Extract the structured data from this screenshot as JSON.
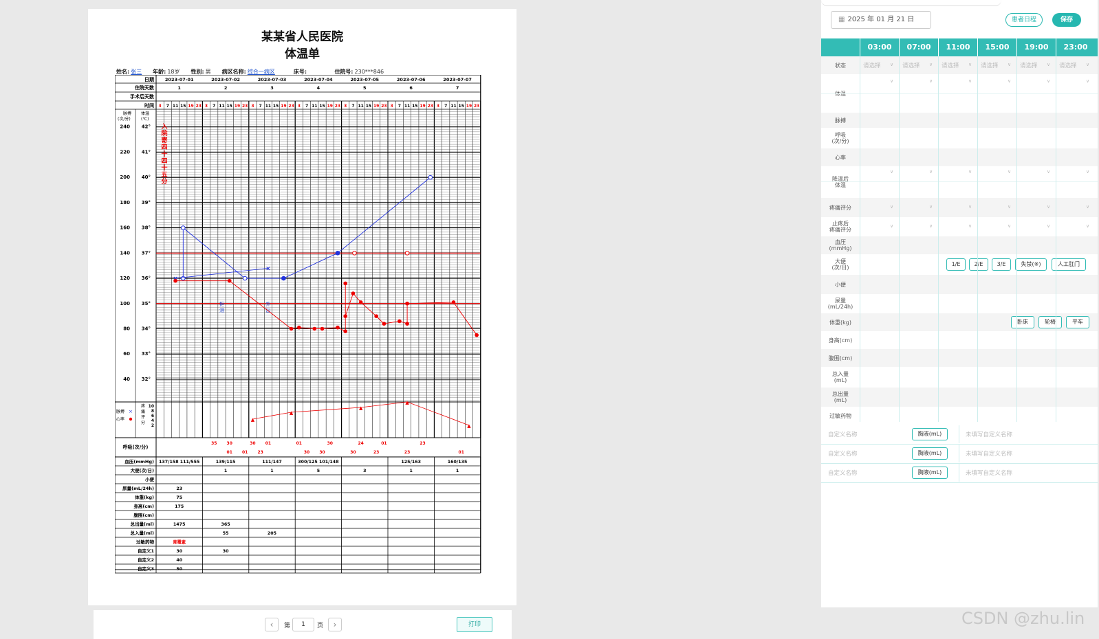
{
  "hospital": "某某省人民医院",
  "doc_title": "体温单",
  "patient": {
    "name_label": "姓名:",
    "name": "张三",
    "age_label": "年龄:",
    "age": "18岁",
    "sex_label": "性别:",
    "sex": "男",
    "ward_label": "病区名称:",
    "ward": "综合一病区",
    "bed_label": "床号:",
    "bed": "",
    "inpatient_label": "住院号:",
    "inpatient_no": "230***846"
  },
  "chart": {
    "row_labels": {
      "date": "日期",
      "days": "住院天数",
      "op_days": "手术后天数",
      "time": "时间"
    },
    "dates": [
      "2023-07-01",
      "2023-07-02",
      "2023-07-03",
      "2023-07-04",
      "2023-07-05",
      "2023-07-06",
      "2023-07-07"
    ],
    "hosp_days": [
      "1",
      "2",
      "3",
      "4",
      "5",
      "6",
      "7"
    ],
    "times": [
      "3",
      "7",
      "11",
      "15",
      "19",
      "23"
    ],
    "pulse_axis_label": "脉搏\n(次/分)",
    "temp_axis_label": "体温\n(℃)",
    "pulse_ticks": [
      "240",
      "220",
      "200",
      "180",
      "160",
      "140",
      "120",
      "100",
      "80",
      "60",
      "40"
    ],
    "temp_ticks": [
      "42°",
      "41°",
      "40°",
      "39°",
      "38°",
      "37°",
      "36°",
      "35°",
      "34°",
      "33°",
      "32°"
    ],
    "admission_note": "入院寄四十四十五分",
    "notes": [
      {
        "day": 1,
        "text": "拒测"
      },
      {
        "day": 2,
        "text": "外出"
      }
    ],
    "legend_pulse": "脉搏",
    "legend_hr": "心率",
    "pain_label": "疼痛评分",
    "pain_ticks": [
      "10",
      "8",
      "6",
      "4",
      "2"
    ],
    "resp_label": "呼吸(次/分)",
    "resp_values": [
      {
        "day": 1,
        "slot": 1,
        "v": "35",
        "lo": false
      },
      {
        "day": 1,
        "slot": 3,
        "v": "30",
        "lo": false
      },
      {
        "day": 1,
        "slot": 3,
        "v": "01",
        "lo": true
      },
      {
        "day": 2,
        "slot": 0,
        "v": "30",
        "lo": false
      },
      {
        "day": 1,
        "slot": 5,
        "v": "01",
        "lo": true
      },
      {
        "day": 2,
        "slot": 2,
        "v": "01",
        "lo": false
      },
      {
        "day": 2,
        "slot": 1,
        "v": "23",
        "lo": true
      },
      {
        "day": 3,
        "slot": 0,
        "v": "01",
        "lo": false
      },
      {
        "day": 3,
        "slot": 1,
        "v": "30",
        "lo": true
      },
      {
        "day": 3,
        "slot": 4,
        "v": "30",
        "lo": false
      },
      {
        "day": 3,
        "slot": 3,
        "v": "30",
        "lo": true
      },
      {
        "day": 4,
        "slot": 2,
        "v": "24",
        "lo": false
      },
      {
        "day": 4,
        "slot": 1,
        "v": "30",
        "lo": true
      },
      {
        "day": 4,
        "slot": 5,
        "v": "01",
        "lo": false
      },
      {
        "day": 4,
        "slot": 4,
        "v": "23",
        "lo": true
      },
      {
        "day": 5,
        "slot": 4,
        "v": "23",
        "lo": false
      },
      {
        "day": 5,
        "slot": 2,
        "v": "23",
        "lo": true
      },
      {
        "day": 6,
        "slot": 3,
        "v": "01",
        "lo": true
      }
    ],
    "bottom_rows": [
      {
        "label": "血压(mmHg)",
        "cells": [
          "137/158  111/555",
          "139/115",
          "111/147",
          "300/125  101/148",
          "",
          "125/163",
          "160/135"
        ]
      },
      {
        "label": "大便(次/日)",
        "cells": [
          "",
          "1",
          "1",
          "5",
          "3",
          "1",
          "1"
        ]
      },
      {
        "label": "小便",
        "cells": [
          "",
          "",
          "",
          "",
          "",
          "",
          ""
        ]
      },
      {
        "label": "尿量(mL/24h)",
        "cells": [
          "23",
          "",
          "",
          "",
          "",
          "",
          ""
        ]
      },
      {
        "label": "体重(kg)",
        "cells": [
          "75",
          "",
          "",
          "",
          "",
          "",
          ""
        ]
      },
      {
        "label": "身高(cm)",
        "cells": [
          "175",
          "",
          "",
          "",
          "",
          "",
          ""
        ]
      },
      {
        "label": "腹围(cm)",
        "cells": [
          "",
          "",
          "",
          "",
          "",
          "",
          ""
        ]
      },
      {
        "label": "总出量(ml)",
        "cells": [
          "1475",
          "365",
          "",
          "",
          "",
          "",
          ""
        ]
      },
      {
        "label": "总入量(ml)",
        "cells": [
          "",
          "55",
          "205",
          "",
          "",
          "",
          ""
        ]
      },
      {
        "label": "过敏药物",
        "cells": [
          "青霉素",
          "",
          "",
          "",
          "",
          "",
          ""
        ]
      },
      {
        "label": "自定义1",
        "cells": [
          "30",
          "30",
          "",
          "",
          "",
          "",
          ""
        ]
      },
      {
        "label": "自定义2",
        "cells": [
          "40",
          "",
          "",
          "",
          "",
          "",
          ""
        ]
      },
      {
        "label": "自定义3",
        "cells": [
          "50",
          "",
          "",
          "",
          "",
          "",
          ""
        ]
      }
    ],
    "temp_series": [
      {
        "day": 0,
        "slot": 3,
        "t": 36.0
      },
      {
        "day": 0,
        "slot": 3,
        "t": 38.0
      },
      {
        "day": 1,
        "slot": 5,
        "t": 36.0
      },
      {
        "day": 2,
        "slot": 4,
        "t": 36.0
      },
      {
        "day": 3,
        "slot": 5,
        "t": 37.0
      },
      {
        "day": 5,
        "slot": 5,
        "t": 40.0
      }
    ],
    "pulse_series": [
      {
        "day": 0,
        "slot": 2,
        "p": 118
      },
      {
        "day": 1,
        "slot": 3,
        "p": 118
      },
      {
        "day": 2,
        "slot": 5,
        "p": 80
      },
      {
        "day": 2,
        "slot": 6,
        "p": 81
      },
      {
        "day": 3,
        "slot": 2,
        "p": 80
      },
      {
        "day": 3,
        "slot": 3,
        "p": 80
      },
      {
        "day": 3,
        "slot": 5,
        "p": 81
      },
      {
        "day": 3,
        "slot": 6,
        "p": 78
      },
      {
        "day": 4,
        "slot": 0,
        "p": 116
      },
      {
        "day": 4,
        "slot": 0,
        "p": 90
      },
      {
        "day": 4,
        "slot": 1,
        "p": 108
      },
      {
        "day": 4,
        "slot": 2,
        "p": 101
      },
      {
        "day": 4,
        "slot": 4,
        "p": 90
      },
      {
        "day": 4,
        "slot": 5,
        "p": 84
      },
      {
        "day": 5,
        "slot": 1,
        "p": 86
      },
      {
        "day": 5,
        "slot": 2,
        "p": 84
      },
      {
        "day": 5,
        "slot": 2,
        "p": 100
      },
      {
        "day": 6,
        "slot": 2,
        "p": 101
      },
      {
        "day": 6,
        "slot": 5,
        "p": 75
      }
    ]
  },
  "pager": {
    "prefix": "第",
    "page": "1",
    "suffix": "页",
    "print": "打印"
  },
  "right": {
    "date": "2025 年 01 月 21 日",
    "schedule_btn": "患者日程",
    "save_btn": "保存",
    "times": [
      "03:00",
      "07:00",
      "11:00",
      "15:00",
      "19:00",
      "23:00"
    ],
    "labels": {
      "status": "状态",
      "temp": "体温",
      "pulse": "脉搏",
      "resp": "呼吸\n(次/分)",
      "hr": "心率",
      "cool": "降温后\n体温",
      "pain": "疼痛评分",
      "pain2": "止疼后\n疼痛评分",
      "bp": "血压\n(mmHg)",
      "stool": "大便\n(次/日)",
      "urine": "小便",
      "urine_vol": "尿量\n(mL/24h)",
      "weight": "体重(kg)",
      "height": "身高(cm)",
      "waist": "腹围(cm)",
      "intake": "总入量\n(mL)",
      "output": "总出量\n(mL)",
      "allergy": "过敏药物"
    },
    "select_placeholder": "请选择",
    "stool_btns": [
      "1/E",
      "2/E",
      "3/E",
      "失禁(※)",
      "人工肛门"
    ],
    "weight_btns": [
      "卧床",
      "轮椅",
      "平车"
    ],
    "custom_rows": [
      {
        "name": "自定义名称",
        "btn": "胸液(mL)",
        "input": "未填写自定义名称"
      },
      {
        "name": "自定义名称",
        "btn": "胸液(mL)",
        "input": "未填写自定义名称"
      },
      {
        "name": "自定义名称",
        "btn": "胸液(mL)",
        "input": "未填写自定义名称"
      }
    ]
  },
  "watermark": "CSDN @zhu.lin"
}
